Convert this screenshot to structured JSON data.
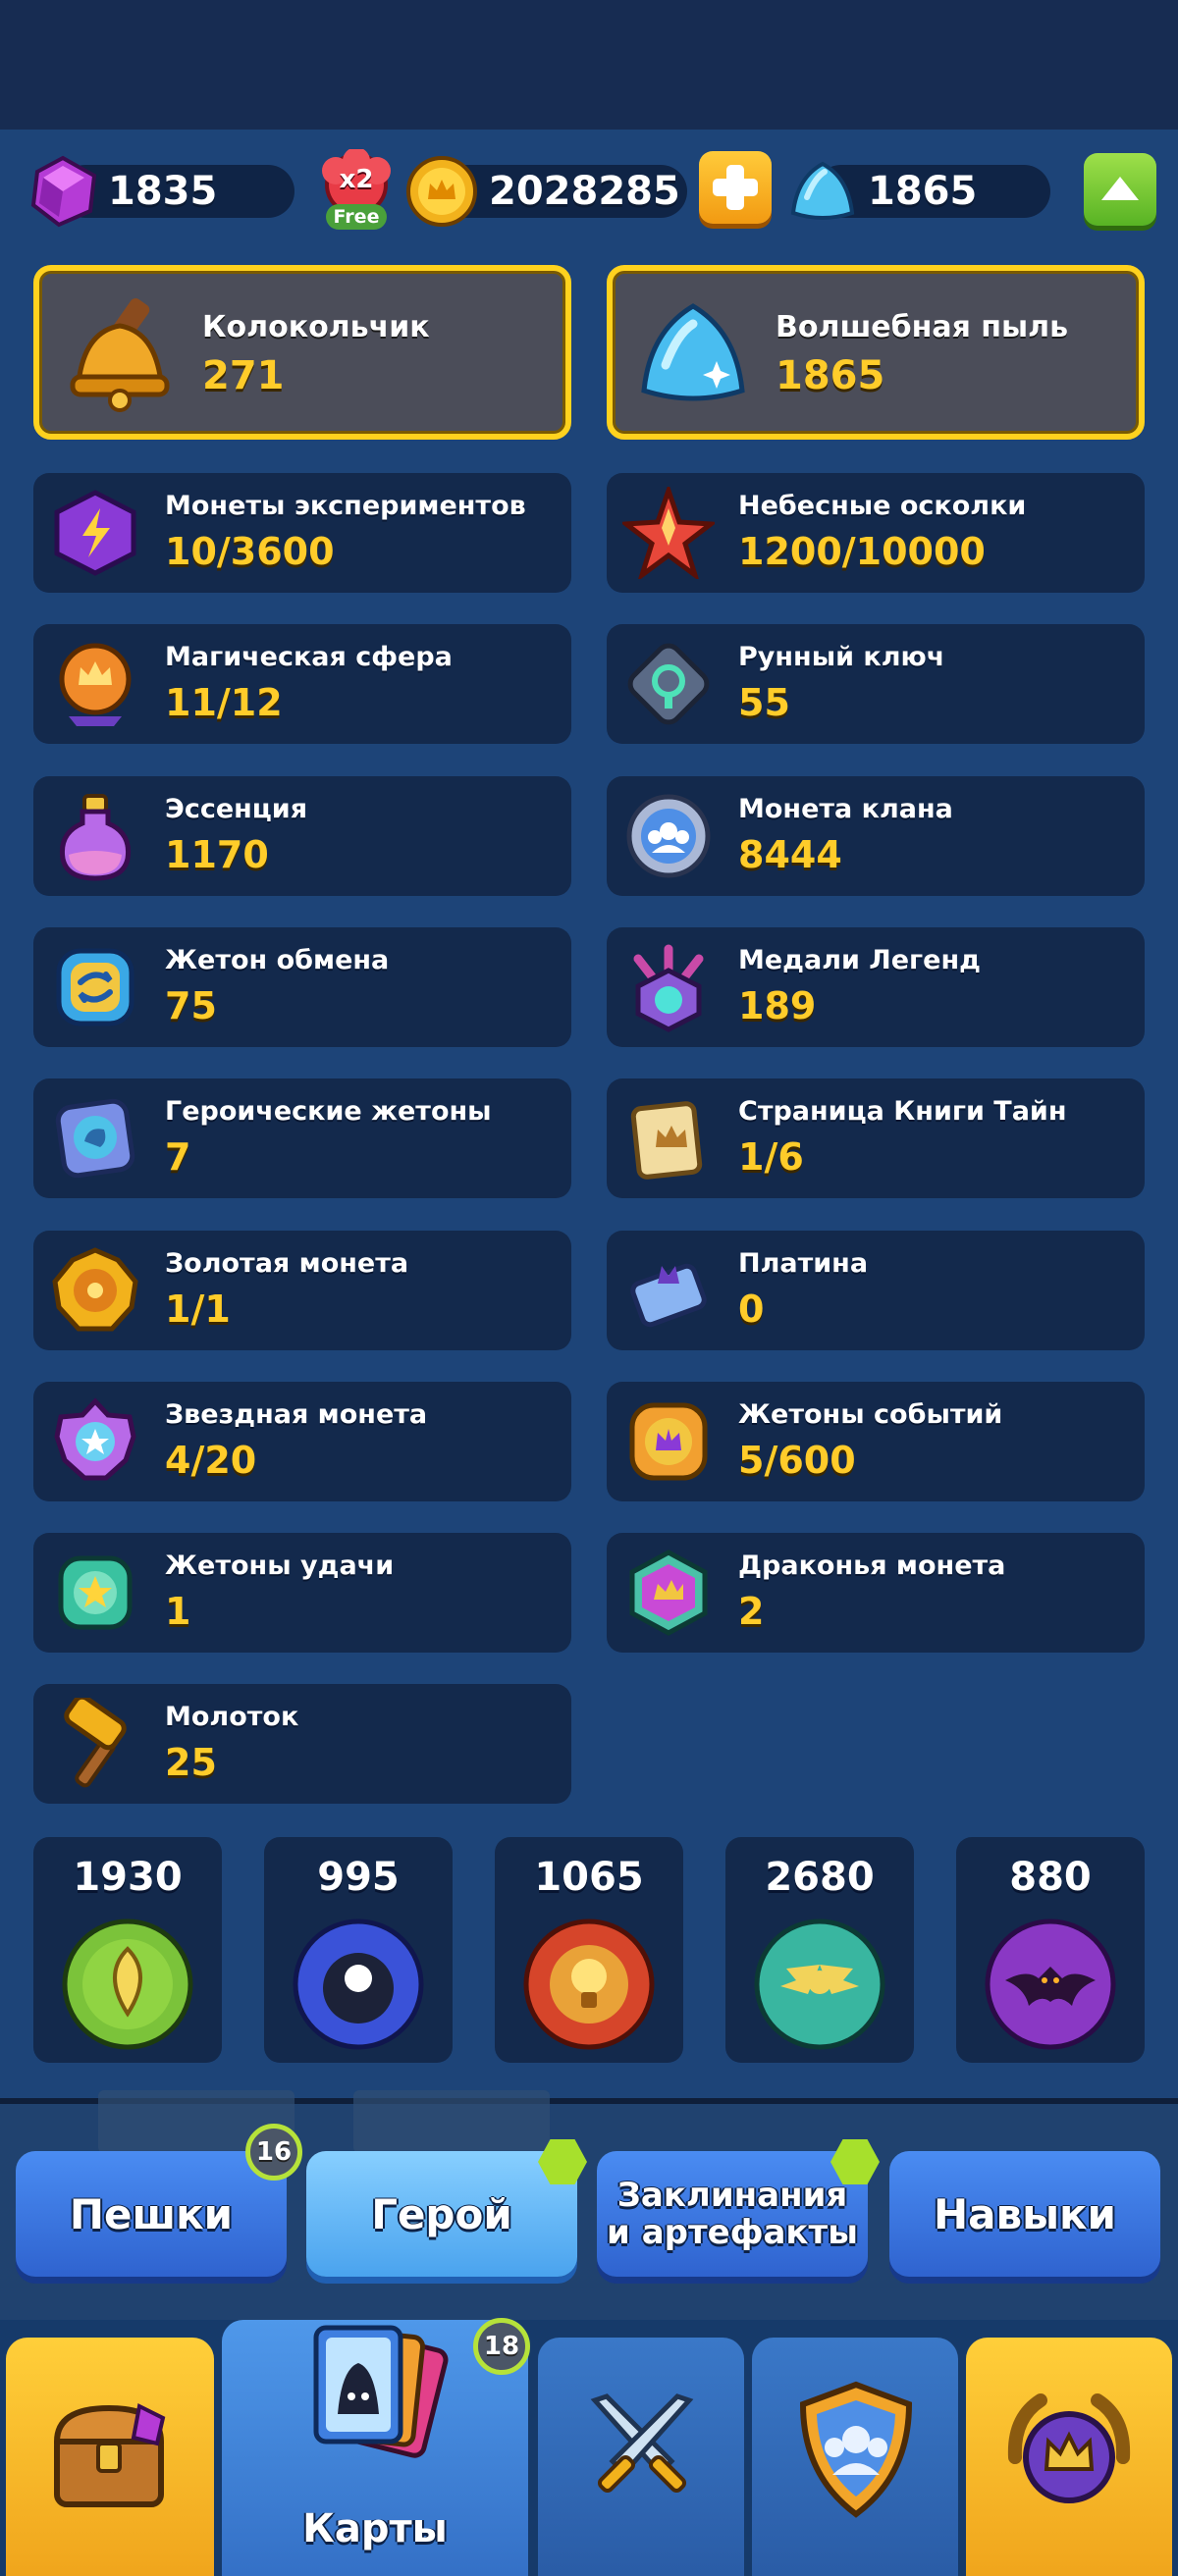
{
  "currency_bar": {
    "gems": "1835",
    "x2_badge": "x2",
    "free_label": "Free",
    "coins": "2028285",
    "magic_dust": "1865"
  },
  "featured": [
    {
      "name": "Колокольчик",
      "value": "271",
      "icon": "bell-icon"
    },
    {
      "name": "Волшебная пыль",
      "value": "1865",
      "icon": "magic-dust-icon"
    }
  ],
  "resources": [
    {
      "name": "Монеты экспериментов",
      "value": "10/3600",
      "icon": "experiment-coin-icon"
    },
    {
      "name": "Небесные осколки",
      "value": "1200/10000",
      "icon": "celestial-shard-icon"
    },
    {
      "name": "Магическая сфера",
      "value": "11/12",
      "icon": "magic-sphere-icon"
    },
    {
      "name": "Рунный ключ",
      "value": "55",
      "icon": "rune-key-icon"
    },
    {
      "name": "Эссенция",
      "value": "1170",
      "icon": "essence-potion-icon"
    },
    {
      "name": "Монета клана",
      "value": "8444",
      "icon": "clan-coin-icon"
    },
    {
      "name": "Жетон обмена",
      "value": "75",
      "icon": "exchange-token-icon"
    },
    {
      "name": "Медали Легенд",
      "value": "189",
      "icon": "legend-medal-icon"
    },
    {
      "name": "Героические жетоны",
      "value": "7",
      "icon": "heroic-token-icon"
    },
    {
      "name": "Страница Книги Тайн",
      "value": "1/6",
      "icon": "book-page-icon"
    },
    {
      "name": "Золотая монета",
      "value": "1/1",
      "icon": "gold-coin-icon"
    },
    {
      "name": "Платина",
      "value": "0",
      "icon": "platinum-icon"
    },
    {
      "name": "Звездная монета",
      "value": "4/20",
      "icon": "star-coin-icon"
    },
    {
      "name": "Жетоны событий",
      "value": "5/600",
      "icon": "event-token-icon"
    },
    {
      "name": "Жетоны удачи",
      "value": "1",
      "icon": "luck-token-icon"
    },
    {
      "name": "Драконья монета",
      "value": "2",
      "icon": "dragon-coin-icon"
    },
    {
      "name": "Молоток",
      "value": "25",
      "icon": "hammer-icon"
    }
  ],
  "orbs": [
    {
      "value": "1930",
      "icon": "nature-orb-icon",
      "color": "#7bc33a"
    },
    {
      "value": "995",
      "icon": "eight-ball-orb-icon",
      "color": "#3a52d8"
    },
    {
      "value": "1065",
      "icon": "lightbulb-orb-icon",
      "color": "#d6452a"
    },
    {
      "value": "2680",
      "icon": "winged-orb-icon",
      "color": "#39b6a0"
    },
    {
      "value": "880",
      "icon": "bat-orb-icon",
      "color": "#8a38c4"
    }
  ],
  "tabs": {
    "pawns": "Пешки",
    "pawns_badge": "16",
    "hero": "Герой",
    "spells_line1": "Заклинания",
    "spells_line2": "и артефакты",
    "skills": "Навыки"
  },
  "nav": {
    "cards_label": "Карты",
    "cards_badge": "18"
  },
  "colors": {
    "accent_gold": "#ffcc2a",
    "badge_green": "#a7e02c",
    "panel": "#13294c"
  }
}
